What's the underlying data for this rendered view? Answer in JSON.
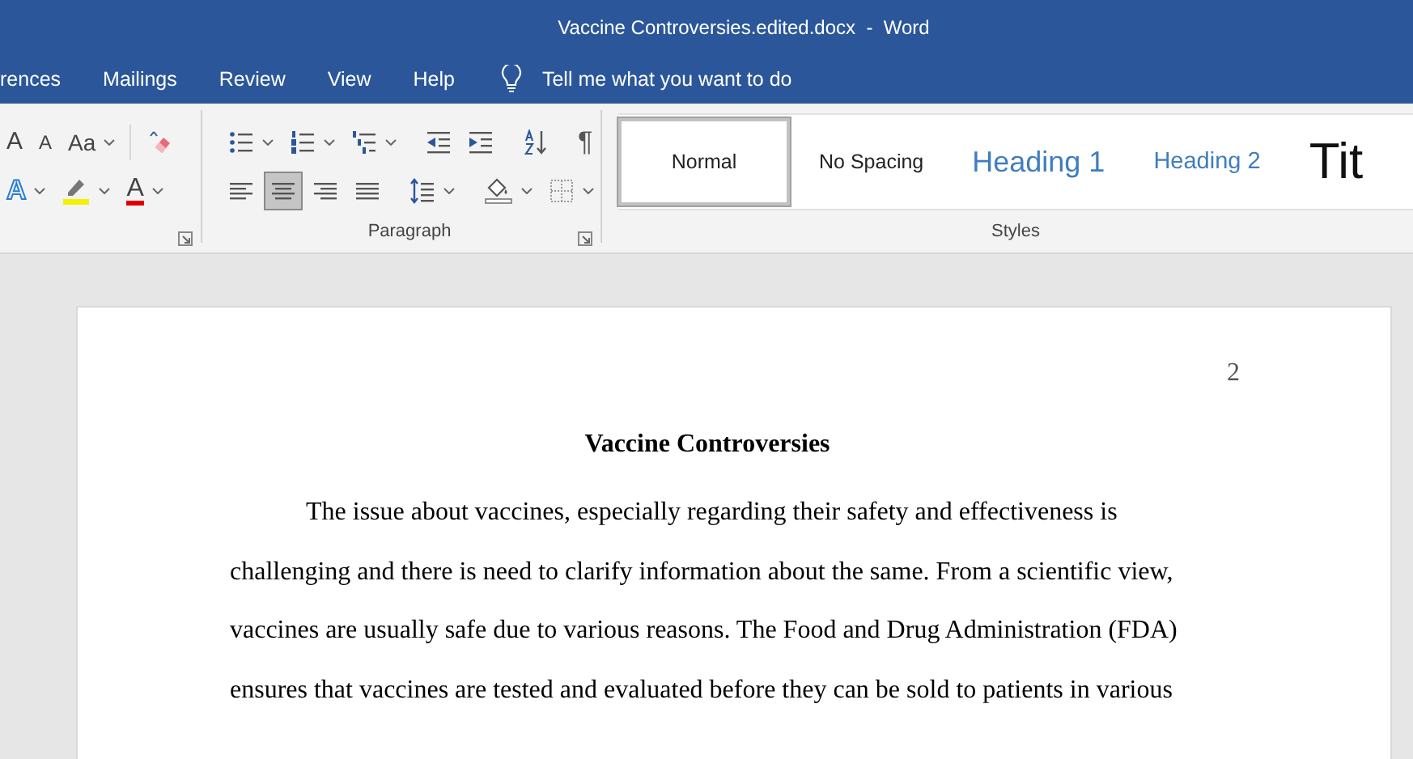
{
  "window": {
    "title": "Vaccine Controversies.edited.docx  -  Word"
  },
  "tabs": [
    {
      "label": "rences",
      "selected": false
    },
    {
      "label": "Mailings",
      "selected": false
    },
    {
      "label": "Review",
      "selected": false
    },
    {
      "label": "View",
      "selected": false
    },
    {
      "label": "Help",
      "selected": false
    }
  ],
  "tell_me": {
    "placeholder": "Tell me what you want to do"
  },
  "ribbon": {
    "font_group": {
      "row1": [
        {
          "kind": "grow_font",
          "glyph": "A"
        },
        {
          "kind": "shrink_font",
          "glyph": "A"
        },
        {
          "kind": "change_case",
          "glyph": "Aa",
          "dropdown": true
        },
        {
          "kind": "clear_formatting"
        }
      ],
      "row2": [
        {
          "kind": "text_effects",
          "glyph": "A",
          "dropdown": true
        },
        {
          "kind": "highlight",
          "dropdown": true
        },
        {
          "kind": "font_color",
          "glyph": "A",
          "dropdown": true
        }
      ]
    },
    "paragraph_group": {
      "label": "Paragraph",
      "row1": [
        {
          "kind": "bullets",
          "dropdown": true
        },
        {
          "kind": "numbering",
          "dropdown": true
        },
        {
          "kind": "multilevel",
          "dropdown": true
        },
        {
          "kind": "decrease_indent"
        },
        {
          "kind": "increase_indent"
        },
        {
          "kind": "sort"
        },
        {
          "kind": "pilcrow",
          "glyph": "¶"
        }
      ],
      "alignment": [
        {
          "kind": "align_left",
          "selected": false
        },
        {
          "kind": "align_center",
          "selected": true
        },
        {
          "kind": "align_right",
          "selected": false
        },
        {
          "kind": "justify",
          "selected": false
        }
      ],
      "row2": [
        {
          "kind": "line_spacing",
          "dropdown": true
        },
        {
          "kind": "shading",
          "dropdown": true
        },
        {
          "kind": "borders",
          "dropdown": true
        }
      ]
    },
    "styles_group": {
      "label": "Styles",
      "items": [
        {
          "label": "Normal",
          "kind": "normal",
          "selected": true
        },
        {
          "label": "No Spacing",
          "kind": "normal",
          "selected": false
        },
        {
          "label": "Heading 1",
          "kind": "heading1",
          "selected": false
        },
        {
          "label": "Heading 2",
          "kind": "heading2",
          "selected": false
        },
        {
          "label": "Tit",
          "kind": "title",
          "selected": false
        }
      ]
    }
  },
  "document": {
    "page_number": "2",
    "heading": "Vaccine Controversies",
    "paragraph": "The issue about vaccines, especially regarding their safety and effectiveness is challenging and there is need to clarify information about the same. From a scientific view, vaccines are usually safe due to various reasons. The Food and Drug Administration (FDA) ensures that vaccines are tested and evaluated before they can be sold to patients in various"
  }
}
